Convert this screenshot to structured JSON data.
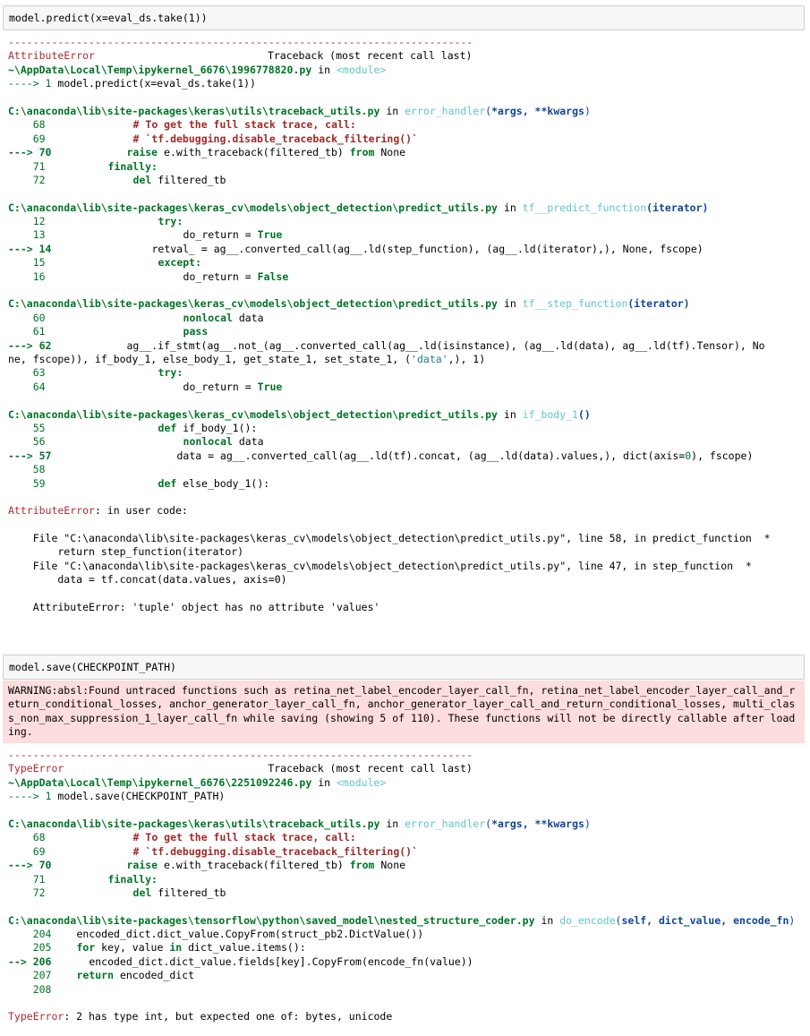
{
  "cell1": {
    "input": "model.predict(x=eval_ds.take(1))",
    "separator": "---------------------------------------------------------------------------",
    "error_name": "AttributeError",
    "traceback_header": "Traceback (most recent call last)",
    "frames": [
      {
        "file": "~\\AppData\\Local\\Temp\\ipykernel_6676\\1996778820.py",
        "in": " in ",
        "func": "<module>",
        "args": "",
        "lines": [
          {
            "arrow": "----> 1 ",
            "num": "",
            "code": "model.predict(x=eval_ds.take(1))",
            "style": "plain"
          }
        ]
      }
    ]
  },
  "labels": {
    "in_word": " in ",
    "arrow70": "---> 70",
    "arrow14": "---> 14",
    "arrow62": "---> 62",
    "arrow57": "---> 57",
    "arrow206": "--> 206",
    "arrow1": "----> 1",
    "arrow1b": "----> 1"
  },
  "tb1": {
    "f1_path": "C:\\anaconda\\lib\\site-packages\\keras\\utils\\traceback_utils.py",
    "f1_func": "error_handler",
    "f1_args_open": "(",
    "f1_args": "*args, **kwargs",
    "f1_args_close": ")",
    "l68": "    68",
    "c68": "# To get the full stack trace, call:",
    "l69": "    69",
    "c69": "# `tf.debugging.disable_traceback_filtering()`",
    "c70a": "raise",
    "c70b": " e.with_traceback(filtered_tb) ",
    "c70c": "from",
    "c70d": " None",
    "l71": "    71",
    "c71": "finally:",
    "l72": "    72",
    "c72a": "del",
    "c72b": " filtered_tb",
    "f2_path": "C:\\anaconda\\lib\\site-packages\\keras_cv\\models\\object_detection\\predict_utils.py",
    "f2_func": "tf__predict_function",
    "f2_args": "(iterator)",
    "l12": "    12",
    "c12": "try:",
    "l13": "    13",
    "c13a": "do_return = ",
    "c13b": "True",
    "c14": "retval_ = ag__.converted_call(ag__.ld(step_function), (ag__.ld(iterator),), None, fscope)",
    "l15": "    15",
    "c15": "except:",
    "l16": "    16",
    "c16a": "do_return = ",
    "c16b": "False",
    "f3_path": "C:\\anaconda\\lib\\site-packages\\keras_cv\\models\\object_detection\\predict_utils.py",
    "f3_func": "tf__step_function",
    "f3_args": "(iterator)",
    "l60": "    60",
    "c60a": "nonlocal",
    "c60b": " data",
    "l61": "    61",
    "c61": "pass",
    "c62a": "ag__.if_stmt(ag__.not_(ag__.converted_call(ag__.ld(isinstance), (ag__.ld(data), ag__.ld(tf).Tensor), No",
    "c62b": "ne, fscope)), if_body_1, else_body_1, get_state_1, set_state_1, (",
    "c62c": "'data'",
    "c62d": ",), 1)",
    "l63": "    63",
    "c63": "try:",
    "l64": "    64",
    "c64a": "do_return = ",
    "c64b": "True",
    "f4_path": "C:\\anaconda\\lib\\site-packages\\keras_cv\\models\\object_detection\\predict_utils.py",
    "f4_func": "if_body_1",
    "f4_args": "()",
    "l55": "    55",
    "c55a": "def",
    "c55b": " if_body_1():",
    "l56": "    56",
    "c56a": "nonlocal",
    "c56b": " data",
    "c57a": "data = ag__.converted_call(ag__.ld(tf).concat, (ag__.ld(data).values,), dict(axis=",
    "c57b": "0",
    "c57c": "), fscope)",
    "l58": "    58",
    "l59": "    59",
    "c59a": "def",
    "c59b": " else_body_1():",
    "final_err": "AttributeError",
    "final_msg": ": in user code:",
    "uc1": "    File \"C:\\anaconda\\lib\\site-packages\\keras_cv\\models\\object_detection\\predict_utils.py\", line 58, in predict_function  *",
    "uc2": "        return step_function(iterator)",
    "uc3": "    File \"C:\\anaconda\\lib\\site-packages\\keras_cv\\models\\object_detection\\predict_utils.py\", line 47, in step_function  *",
    "uc4": "        data = tf.concat(data.values, axis=0)",
    "uc5": "    AttributeError: 'tuple' object has no attribute 'values'"
  },
  "cell2": {
    "input": "model.save(CHECKPOINT_PATH)",
    "warning": [
      "WARNING:absl:Found untraced functions such as retina_net_label_encoder_layer_call_fn, retina_net_label_encoder_layer_call_and_r",
      "eturn_conditional_losses, anchor_generator_layer_call_fn, anchor_generator_layer_call_and_return_conditional_losses, multi_clas",
      "s_non_max_suppression_1_layer_call_fn while saving (showing 5 of 110). These functions will not be directly callable after load",
      "ing."
    ],
    "separator": "---------------------------------------------------------------------------",
    "error_name": "TypeError",
    "traceback_header": "Traceback (most recent call last)",
    "mod_path": "~\\AppData\\Local\\Temp\\ipykernel_6676\\2251092246.py",
    "mod_func": "<module>",
    "mod_code": " model.save(CHECKPOINT_PATH)",
    "f1_path": "C:\\anaconda\\lib\\site-packages\\keras\\utils\\traceback_utils.py",
    "f1_func": "error_handler",
    "f1_args": "*args, **kwargs",
    "f2_path": "C:\\anaconda\\lib\\site-packages\\tensorflow\\python\\saved_model\\nested_structure_coder.py",
    "f2_func": "do_encode",
    "f2_args": "self, dict_value, encode_fn",
    "l204": "    204",
    "c204": "encoded_dict.dict_value.CopyFrom(struct_pb2.DictValue())",
    "l205": "    205",
    "c205a": "for",
    "c205b": " key, value ",
    "c205c": "in",
    "c205d": " dict_value.items():",
    "c206": "  encoded_dict.dict_value.fields[key].CopyFrom(encode_fn(value))",
    "l207": "    207",
    "c207a": "return",
    "c207b": " encoded_dict",
    "l208": "    208",
    "final_err": "TypeError",
    "final_msg": ": 2 has type int, but expected one of: bytes, unicode"
  },
  "input1_label": "model.predict(x=eval_ds.take(1))"
}
